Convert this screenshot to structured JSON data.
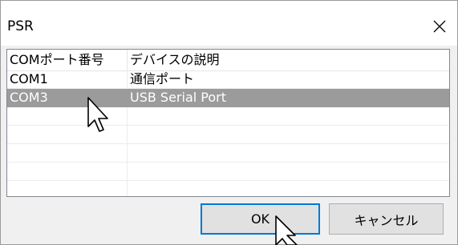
{
  "window": {
    "title": "PSR",
    "close_glyph": "✕"
  },
  "list": {
    "columns": [
      "COMポート番号",
      "デバイスの説明"
    ],
    "rows": [
      {
        "port": "COM1",
        "description": "通信ポート",
        "selected": false
      },
      {
        "port": "COM3",
        "description": "USB Serial Port",
        "selected": true
      }
    ]
  },
  "buttons": {
    "ok_label": "OK",
    "cancel_label": "キャンセル"
  },
  "colors": {
    "selection": "#9b9b9b",
    "default_button_border": "#0078d7"
  },
  "cursors": [
    "arrow-cursor",
    "arrow-cursor"
  ]
}
